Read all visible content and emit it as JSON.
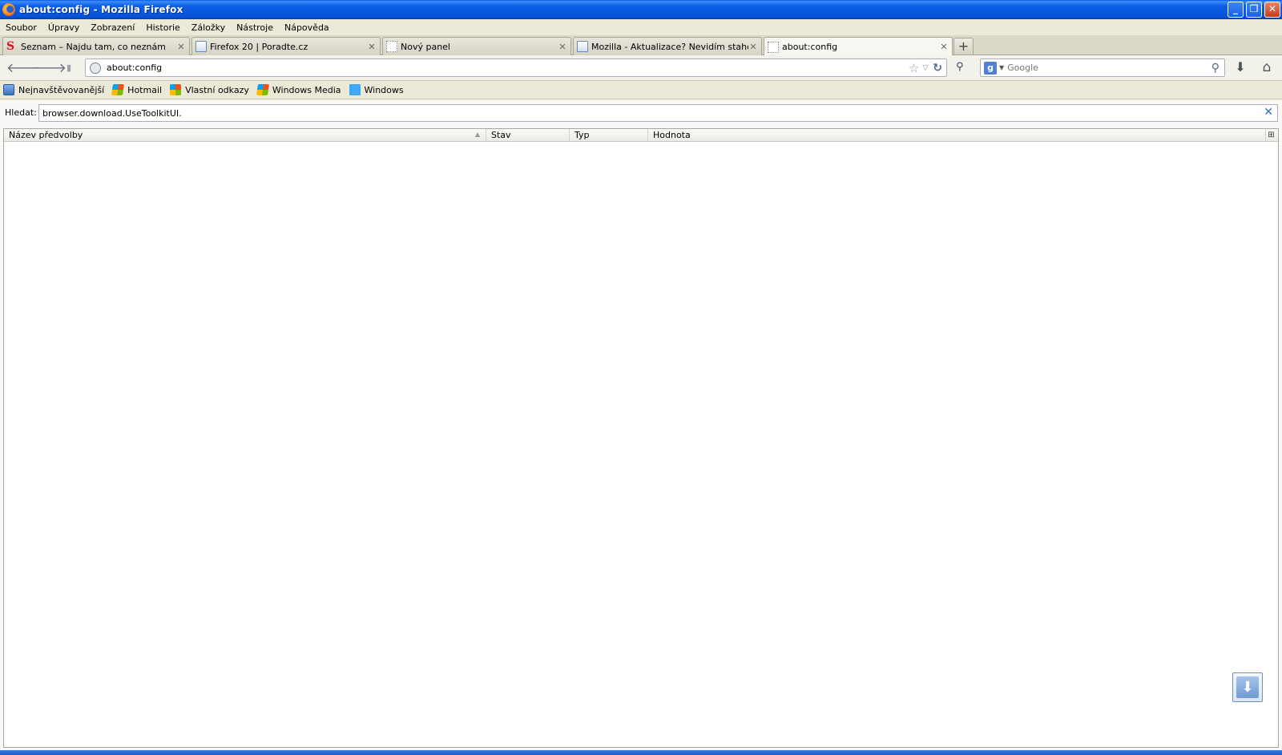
{
  "window": {
    "title": "about:config - Mozilla Firefox",
    "minimize_glyph": "_",
    "maximize_glyph": "❐",
    "close_glyph": "✕"
  },
  "menu": [
    "Soubor",
    "Úpravy",
    "Zobrazení",
    "Historie",
    "Záložky",
    "Nástroje",
    "Nápověda"
  ],
  "tabs": [
    {
      "label": "Seznam – Najdu tam, co neznám",
      "icon": "seznam-icon",
      "active": false
    },
    {
      "label": "Firefox 20 | Poradte.cz",
      "icon": "page-icon",
      "active": false
    },
    {
      "label": "Nový panel",
      "icon": "blank-page-icon",
      "active": false
    },
    {
      "label": "Mozilla - Aktualizace? Nevidím stahovaní ...",
      "icon": "page-icon",
      "active": false
    },
    {
      "label": "about:config",
      "icon": "blank-page-icon",
      "active": true
    }
  ],
  "tab_close_glyph": "✕",
  "new_tab_glyph": "+",
  "nav": {
    "back_glyph": "🡐",
    "forward_glyph": "🡒",
    "signal_glyph": "▮",
    "url": "about:config",
    "star_glyph": "☆",
    "dropdown_glyph": "▽",
    "reload_glyph": "↻",
    "addon_glyph": "⚲",
    "search_engine_letter": "g",
    "search_engine_drop_glyph": "▼",
    "search_placeholder": "Google",
    "search_glyph": "⚲",
    "download_glyph": "⬇",
    "home_glyph": "⌂"
  },
  "bookmarks": [
    {
      "label": "Nejnavštěvovanější",
      "icon": "most-visited-icon"
    },
    {
      "label": "Hotmail",
      "icon": "windows-logo-icon"
    },
    {
      "label": "Vlastní odkazy",
      "icon": "windows-logo-icon"
    },
    {
      "label": "Windows Media",
      "icon": "windows-logo-icon"
    },
    {
      "label": "Windows",
      "icon": "windows-flag-icon"
    }
  ],
  "config": {
    "filter_label": "Hledat:",
    "filter_value": "browser.download.UseToolkitUI.",
    "clear_glyph": "✕",
    "columns": [
      "Název předvolby",
      "Stav",
      "Typ",
      "Hodnota"
    ],
    "sort_glyph": "▲",
    "column_picker_glyph": "⊞",
    "rows": []
  },
  "download_notify_glyph": "⬇",
  "colors": {
    "titlebar": "#0a5fe6",
    "chrome": "#ece9d8",
    "content_bg": "#f9f8f6"
  }
}
